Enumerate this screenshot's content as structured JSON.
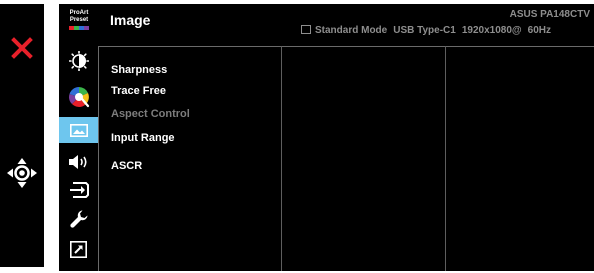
{
  "osd": {
    "title": "Image",
    "model": "ASUS PA148CTV",
    "status": {
      "mode": "Standard Mode",
      "input": "USB Type-C1",
      "resolution": "1920x1080@",
      "refresh": "60Hz"
    },
    "proart_preset": "ProArt Preset",
    "proart_line1": "ProArt",
    "proart_line2": "Preset"
  },
  "nav": [
    {
      "name": "brightness",
      "icon": "sun-icon"
    },
    {
      "name": "color",
      "icon": "color-wheel-icon"
    },
    {
      "name": "image",
      "icon": "image-icon",
      "active": true
    },
    {
      "name": "sound",
      "icon": "speaker-icon"
    },
    {
      "name": "input-select",
      "icon": "input-icon"
    },
    {
      "name": "system-setup",
      "icon": "wrench-icon"
    },
    {
      "name": "shortcut",
      "icon": "shortcut-icon"
    }
  ],
  "menu": {
    "items": [
      {
        "label": "Sharpness",
        "enabled": true
      },
      {
        "label": "Trace Free",
        "enabled": true
      },
      {
        "label": "Aspect Control",
        "enabled": false
      },
      {
        "label": "Input Range",
        "enabled": true
      },
      {
        "label": "ASCR",
        "enabled": true
      }
    ]
  },
  "controls": {
    "close_icon": "close-icon",
    "dpad_icon": "dpad-icon"
  },
  "colors": {
    "accent": "#6ec6ee",
    "close": "#e8202a",
    "text": "#ffffff",
    "muted": "#8e8e8e",
    "disabled": "#7d7d7d"
  }
}
